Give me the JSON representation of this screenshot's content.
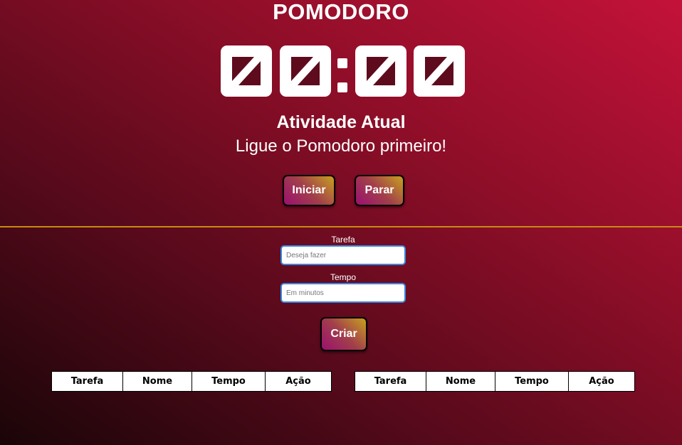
{
  "app": {
    "title": "POMODORO"
  },
  "timer": {
    "display": "00:00"
  },
  "activity": {
    "title": "Atividade Atual",
    "text": "Ligue o Pomodoro primeiro!"
  },
  "controls": {
    "start_label": "Iniciar",
    "stop_label": "Parar"
  },
  "form": {
    "task_label": "Tarefa",
    "task_placeholder": "Deseja fazer",
    "task_value": "",
    "time_label": "Tempo",
    "time_placeholder": "Em minutos",
    "time_value": "",
    "create_label": "Criar"
  },
  "tables": [
    {
      "headers": [
        "Tarefa",
        "Nome",
        "Tempo",
        "Ação"
      ]
    },
    {
      "headers": [
        "Tarefa",
        "Nome",
        "Tempo",
        "Ação"
      ]
    }
  ],
  "colors": {
    "divider": "#c98a12",
    "input_border": "#3a86e0",
    "background_dark": "#1a0508",
    "background_light": "#c4123a"
  }
}
